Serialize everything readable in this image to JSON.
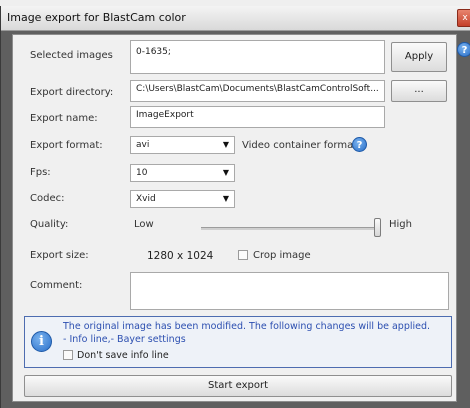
{
  "window": {
    "title": "Image export for BlastCam color",
    "close_glyph": "x"
  },
  "selected_images": {
    "label": "Selected images",
    "value": "0-1635;",
    "apply_label": "Apply"
  },
  "export_directory": {
    "label": "Export directory:",
    "value": "C:\\Users\\BlastCam\\Documents\\BlastCamControlSoft...",
    "browse_label": "..."
  },
  "export_name": {
    "label": "Export name:",
    "value": "ImageExport"
  },
  "export_format": {
    "label": "Export format:",
    "value": "avi",
    "hint": "Video container format"
  },
  "fps": {
    "label": "Fps:",
    "value": "10"
  },
  "codec": {
    "label": "Codec:",
    "value": "Xvid"
  },
  "quality": {
    "label": "Quality:",
    "low": "Low",
    "high": "High",
    "level": 1.0
  },
  "export_size": {
    "label": "Export size:",
    "value": "1280 x 1024",
    "crop_label": "Crop image",
    "crop_checked": false
  },
  "comment": {
    "label": "Comment:",
    "value": ""
  },
  "info": {
    "line1": "The original image has been modified. The following changes will be applied.",
    "line2": "- Info line,- Bayer settings",
    "dont_save_label": "Don't save info line",
    "dont_save_checked": false
  },
  "start_export_label": "Start export",
  "icons": {
    "help": "help-icon",
    "info": "info-icon",
    "close": "close-icon",
    "dropdown": "chevron-down-icon"
  },
  "colors": {
    "info_text": "#2c4fb0",
    "help_icon": "#2a6fc9"
  }
}
